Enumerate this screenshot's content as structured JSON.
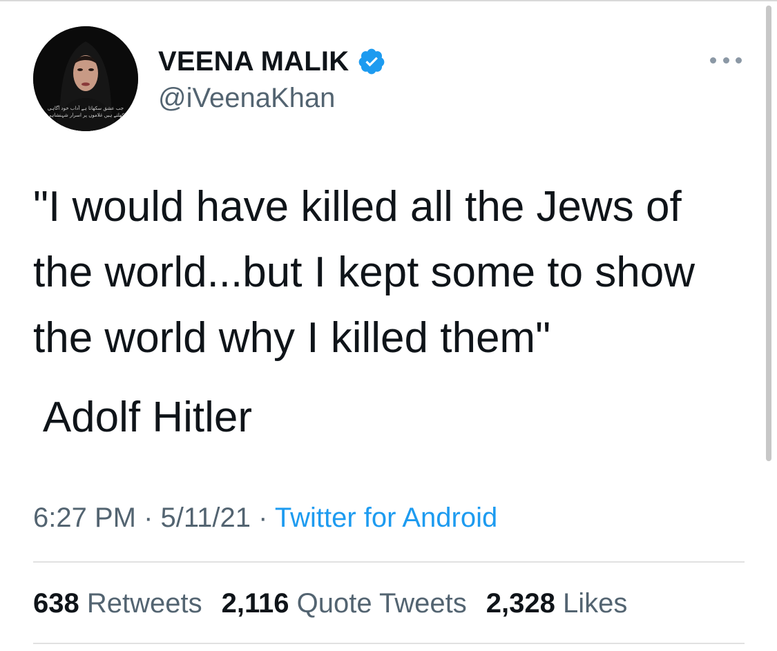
{
  "author": {
    "display_name": "VEENA MALIK",
    "handle": "@iVeenaKhan",
    "verified": true,
    "avatar_caption_lines": [
      "جب عشق سکھاتا ہے آداب خود آگاہی",
      "کھلتے ہیں غلاموں پر اسرار شہنشاہی"
    ]
  },
  "tweet": {
    "text": "\"I would have killed all the Jews of the world...but I kept some to show the world why I killed them\"",
    "attribution": "Adolf Hitler",
    "time": "6:27 PM",
    "separator": " · ",
    "date": "5/11/21",
    "source": "Twitter for Android"
  },
  "stats": {
    "retweets_count": "638",
    "retweets_label": "Retweets",
    "quotes_count": "2,116",
    "quotes_label": "Quote Tweets",
    "likes_count": "2,328",
    "likes_label": "Likes"
  },
  "icons": {
    "verified": "verified-badge-icon",
    "more": "more-options-icon"
  },
  "colors": {
    "text_primary": "#0f1419",
    "text_secondary": "#536471",
    "link": "#1d9bf0",
    "verified": "#1d9bf0"
  }
}
